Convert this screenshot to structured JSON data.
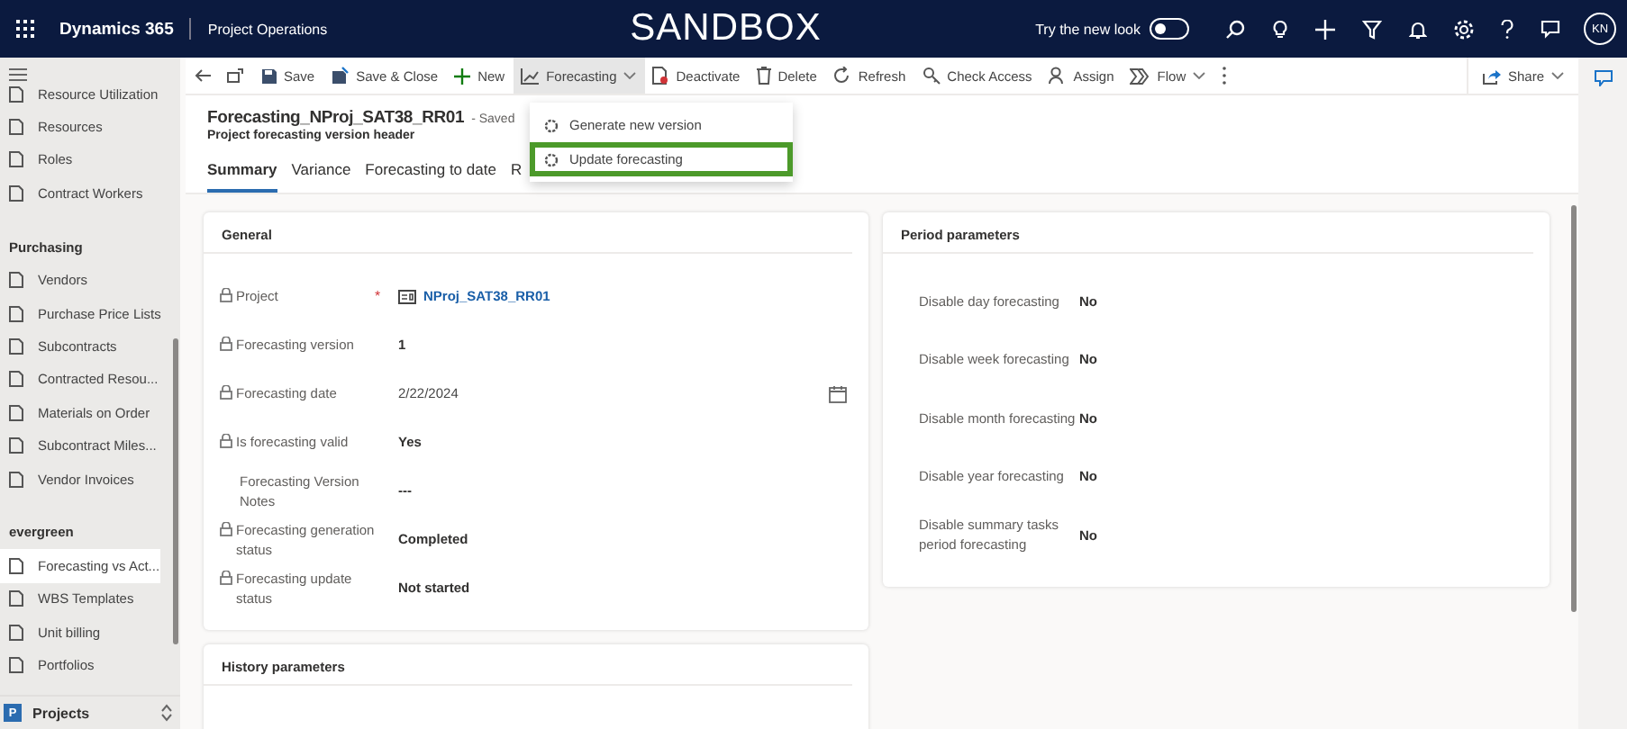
{
  "topbar": {
    "app_name": "Dynamics 365",
    "area": "Project Operations",
    "banner": "SANDBOX",
    "new_look": {
      "label": "Try the new look",
      "on": false
    },
    "avatar": "KN"
  },
  "sidebar": {
    "items": [
      {
        "kind": "item",
        "label": "Resource Utilization",
        "selected": false
      },
      {
        "kind": "item",
        "label": "Resources",
        "selected": false
      },
      {
        "kind": "item",
        "label": "Roles",
        "selected": false
      },
      {
        "kind": "item",
        "label": "Contract Workers",
        "selected": false
      },
      {
        "kind": "header",
        "label": "Purchasing"
      },
      {
        "kind": "item",
        "label": "Vendors",
        "selected": false
      },
      {
        "kind": "item",
        "label": "Purchase Price Lists",
        "selected": false
      },
      {
        "kind": "item",
        "label": "Subcontracts",
        "selected": false
      },
      {
        "kind": "item",
        "label": "Contracted Resou...",
        "selected": false
      },
      {
        "kind": "item",
        "label": "Materials on Order",
        "selected": false
      },
      {
        "kind": "item",
        "label": "Subcontract Miles...",
        "selected": false
      },
      {
        "kind": "item",
        "label": "Vendor Invoices",
        "selected": false
      },
      {
        "kind": "header",
        "label": "evergreen"
      },
      {
        "kind": "item",
        "label": "Forecasting vs Act...",
        "selected": true
      },
      {
        "kind": "item",
        "label": "WBS Templates",
        "selected": false
      },
      {
        "kind": "item",
        "label": "Unit billing",
        "selected": false
      },
      {
        "kind": "item",
        "label": "Portfolios",
        "selected": false
      }
    ],
    "area_switcher": {
      "badge": "P",
      "label": "Projects"
    }
  },
  "commands": [
    {
      "kind": "back",
      "selected": false,
      "dropdown": false
    },
    {
      "kind": "popout",
      "selected": false,
      "dropdown": false
    },
    {
      "kind": "save",
      "label": "Save",
      "selected": false,
      "dropdown": false
    },
    {
      "kind": "save-close",
      "label": "Save & Close",
      "selected": false,
      "dropdown": false
    },
    {
      "kind": "new",
      "label": "New",
      "selected": false,
      "dropdown": false
    },
    {
      "kind": "chart",
      "label": "Forecasting",
      "selected": true,
      "dropdown": true
    },
    {
      "kind": "deactivate",
      "label": "Deactivate",
      "selected": false,
      "dropdown": false
    },
    {
      "kind": "delete",
      "label": "Delete",
      "selected": false,
      "dropdown": false
    },
    {
      "kind": "refresh",
      "label": "Refresh",
      "selected": false,
      "dropdown": false
    },
    {
      "kind": "access",
      "label": "Check Access",
      "selected": false,
      "dropdown": false
    },
    {
      "kind": "assign",
      "label": "Assign",
      "selected": false,
      "dropdown": false
    },
    {
      "kind": "flow",
      "label": "Flow",
      "selected": false,
      "dropdown": true
    },
    {
      "kind": "more",
      "selected": false,
      "dropdown": false
    }
  ],
  "share": "Share",
  "dropdown_menu": [
    {
      "label": "Generate new version",
      "selected": false
    },
    {
      "label": "Update forecasting",
      "selected": true
    }
  ],
  "record": {
    "title": "Forecasting_NProj_SAT38_RR01",
    "status": "- Saved",
    "subtitle": "Project forecasting version header"
  },
  "tabs": [
    {
      "label": "Summary",
      "selected": true
    },
    {
      "label": "Variance",
      "selected": false
    },
    {
      "label": "Forecasting to date",
      "selected": false
    },
    {
      "label": "R",
      "selected": false
    }
  ],
  "general": {
    "title": "General",
    "fields": [
      {
        "label": "Project",
        "locked": true,
        "required_mark": "*",
        "kind": "link",
        "value": "NProj_SAT38_RR01"
      },
      {
        "label": "Forecasting version",
        "locked": true,
        "kind": "text",
        "value": "1"
      },
      {
        "label": "Forecasting date",
        "locked": true,
        "kind": "date",
        "value": "2/22/2024"
      },
      {
        "label": "Is forecasting valid",
        "locked": true,
        "kind": "text",
        "value": "Yes"
      },
      {
        "label": "Forecasting Version Notes",
        "locked": false,
        "kind": "text",
        "value": "---"
      },
      {
        "label": "Forecasting generation status",
        "locked": true,
        "kind": "text",
        "value": "Completed"
      },
      {
        "label": "Forecasting update status",
        "locked": true,
        "kind": "text",
        "value": "Not started"
      }
    ]
  },
  "period": {
    "title": "Period parameters",
    "fields": [
      {
        "label": "Disable day forecasting",
        "value": "No"
      },
      {
        "label": "Disable week forecasting",
        "value": "No"
      },
      {
        "label": "Disable month forecasting",
        "value": "No"
      },
      {
        "label": "Disable year forecasting",
        "value": "No"
      },
      {
        "label": "Disable summary tasks period forecasting",
        "value": "No"
      }
    ]
  },
  "history": {
    "title": "History parameters"
  }
}
